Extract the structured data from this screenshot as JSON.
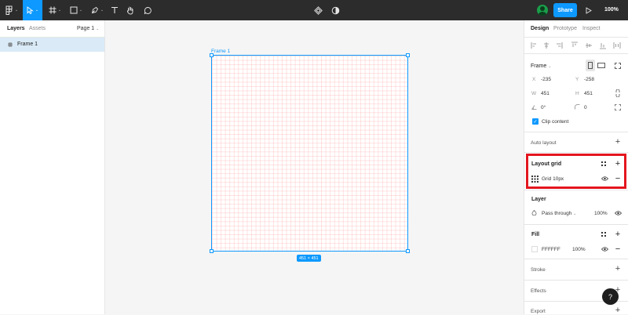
{
  "toolbar": {
    "tools": [
      {
        "name": "main-menu",
        "icon": "figma-logo-icon"
      },
      {
        "name": "move-tool",
        "icon": "cursor-arrow-icon",
        "active": true
      },
      {
        "name": "frame-tool",
        "icon": "frame-hash-icon"
      },
      {
        "name": "shape-tool",
        "icon": "rectangle-icon"
      },
      {
        "name": "pen-tool",
        "icon": "pen-icon"
      },
      {
        "name": "text-tool",
        "icon": "text-t-icon"
      },
      {
        "name": "hand-tool",
        "icon": "hand-icon"
      },
      {
        "name": "comment-tool",
        "icon": "comment-bubble-icon"
      }
    ],
    "share_label": "Share",
    "zoom_label": "100%"
  },
  "left_panel": {
    "tabs": [
      "Layers",
      "Assets"
    ],
    "page_label": "Page 1",
    "layers": [
      {
        "name": "Frame 1",
        "icon": "frame-hash-icon",
        "selected": true
      }
    ]
  },
  "canvas": {
    "frame_label": "Frame 1",
    "size_badge": "451 × 451"
  },
  "right_panel": {
    "tabs": [
      "Design",
      "Prototype",
      "Inspect"
    ],
    "frame": {
      "label": "Frame",
      "x_label": "X",
      "x_value": "-235",
      "y_label": "Y",
      "y_value": "-258",
      "w_label": "W",
      "w_value": "451",
      "h_label": "H",
      "h_value": "451",
      "rotation_value": "0°",
      "radius_value": "0",
      "clip_content_label": "Clip content",
      "clip_content_checked": true
    },
    "auto_layout": {
      "label": "Auto layout"
    },
    "layout_grid": {
      "label": "Layout grid",
      "item_label": "Grid 10px"
    },
    "layer": {
      "label": "Layer",
      "blend_mode": "Pass through",
      "opacity": "100%"
    },
    "fill": {
      "label": "Fill",
      "hex": "FFFFFF",
      "opacity": "100%"
    },
    "stroke": {
      "label": "Stroke"
    },
    "effects": {
      "label": "Effects"
    },
    "export": {
      "label": "Export"
    }
  },
  "help_label": "?",
  "colors": {
    "accent": "#0d99ff",
    "highlight": "#e3161e",
    "topbar": "#2c2c2c"
  }
}
